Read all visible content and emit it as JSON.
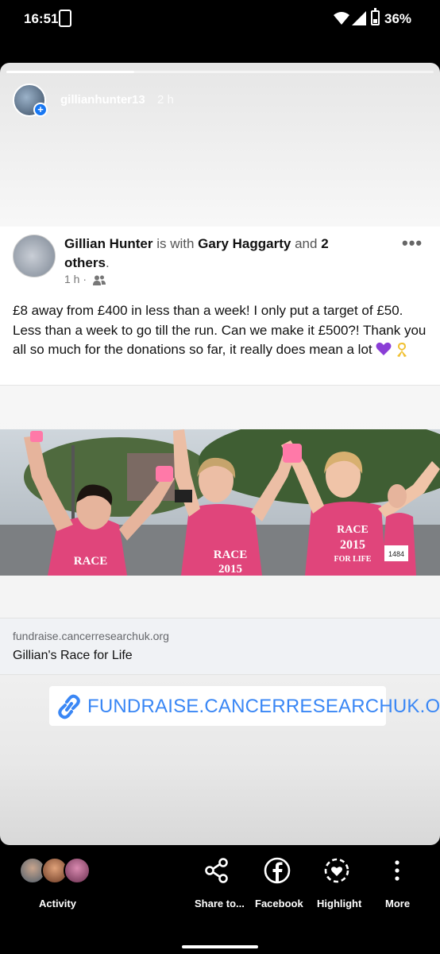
{
  "status_bar": {
    "time": "16:51",
    "battery": "36%"
  },
  "story": {
    "username": "gillianhunter13",
    "time_ago": "2 h",
    "progress": 0.3
  },
  "post": {
    "author": "Gillian Hunter",
    "with_text": "is with",
    "tagged": "Gary Haggarty",
    "and_text": "and",
    "others": "2 others",
    "period": ".",
    "time": "1 h",
    "audience_icon": "friends-icon",
    "text": "£8 away from £400 in less than a week! I only put a target of £50. Less than a week to go till the run. Can we make it £500?! Thank you all so much for the donations so far, it really does mean a lot",
    "emoji": [
      "purple-heart",
      "yellow-ribbon"
    ]
  },
  "link_preview": {
    "domain": "fundraise.cancerresearchuk.org",
    "title": "Gillian's Race for Life"
  },
  "link_sticker": {
    "text": "FUNDRAISE.CANCERRESEARCHUK.ORG"
  },
  "photo": {
    "shirt_text_1": "RACE",
    "shirt_text_2": "2015",
    "shirt_text_3": "FOR LIFE",
    "bib_1": "1484"
  },
  "bottom_bar": {
    "activity": "Activity",
    "share": "Share to...",
    "facebook": "Facebook",
    "highlight": "Highlight",
    "more": "More"
  },
  "colors": {
    "accent": "#1877f2",
    "link_sticker": "#3a87f5",
    "shirt_pink": "#e0457b"
  }
}
